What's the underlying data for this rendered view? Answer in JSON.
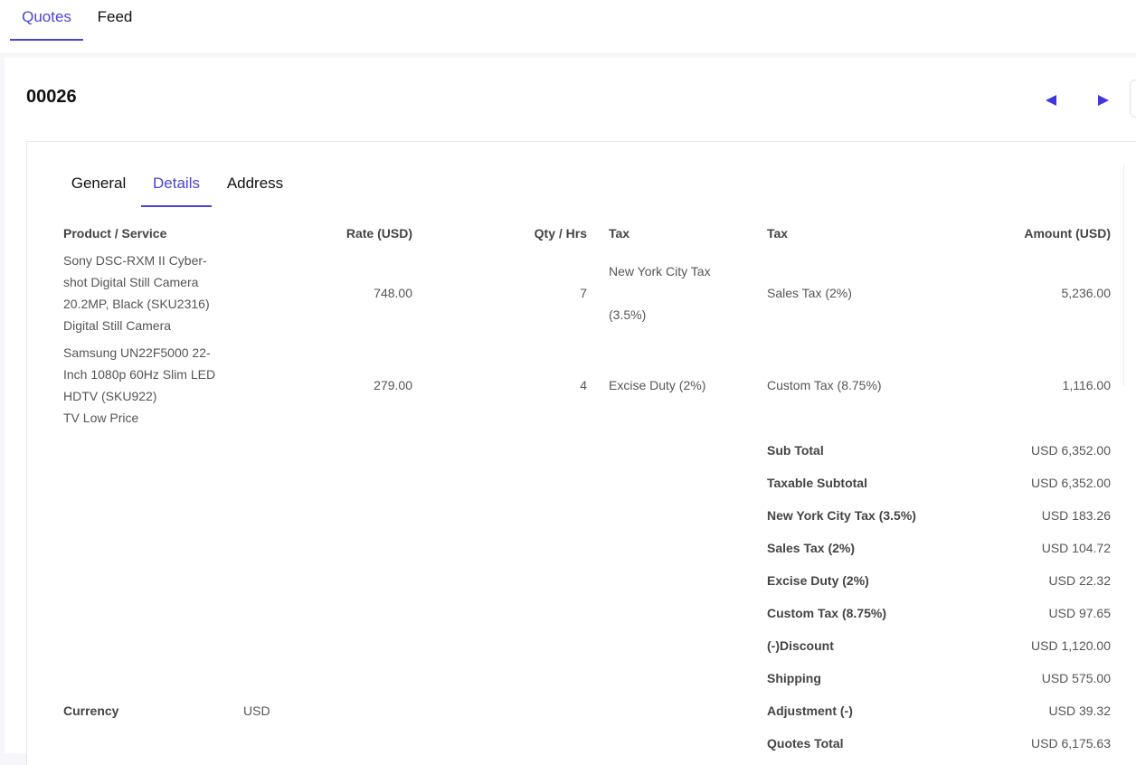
{
  "top_tabs": [
    {
      "label": "Quotes",
      "active": true
    },
    {
      "label": "Feed",
      "active": false
    }
  ],
  "record": {
    "id": "00026"
  },
  "sub_tabs": [
    {
      "label": "General",
      "active": false
    },
    {
      "label": "Details",
      "active": true
    },
    {
      "label": "Address",
      "active": false
    }
  ],
  "table": {
    "headers": [
      "Product / Service",
      "Rate (USD)",
      "Qty / Hrs",
      "Tax",
      "Tax",
      "Amount (USD)"
    ],
    "rows": [
      {
        "product_lines": [
          "Sony DSC-RXM II Cyber-",
          "shot Digital Still Camera",
          "20.2MP, Black (SKU2316)",
          "Digital Still Camera"
        ],
        "rate": "748.00",
        "qty": "7",
        "tax1_lines": [
          "New York City Tax",
          "(3.5%)"
        ],
        "tax2": "Sales Tax (2%)",
        "amount": "5,236.00"
      },
      {
        "product_lines": [
          "Samsung UN22F5000 22-",
          "Inch 1080p 60Hz Slim LED",
          "HDTV (SKU922)",
          "TV Low Price"
        ],
        "rate": "279.00",
        "qty": "4",
        "tax1_lines": [
          "Excise Duty (2%)"
        ],
        "tax2": "Custom Tax (8.75%)",
        "amount": "1,116.00"
      }
    ]
  },
  "summary": [
    {
      "label": "Sub Total",
      "value": "USD 6,352.00"
    },
    {
      "label": "Taxable Subtotal",
      "value": "USD 6,352.00"
    },
    {
      "label": "New York City Tax (3.5%)",
      "value": "USD 183.26"
    },
    {
      "label": "Sales Tax (2%)",
      "value": "USD 104.72"
    },
    {
      "label": "Excise Duty (2%)",
      "value": "USD 22.32"
    },
    {
      "label": "Custom Tax (8.75%)",
      "value": "USD 97.65"
    },
    {
      "label": "(-)Discount",
      "value": "USD 1,120.00"
    },
    {
      "label": "Shipping",
      "value": "USD 575.00"
    },
    {
      "label": "Adjustment (-)",
      "value": "USD 39.32"
    },
    {
      "label": "Quotes Total",
      "value": "USD 6,175.63"
    }
  ],
  "currency": {
    "label": "Currency",
    "value": "USD"
  },
  "colors": {
    "accent": "#4b43d6",
    "nav_arrow": "#3f37e0"
  },
  "icons": {
    "prev": "triangle-left-icon",
    "next": "triangle-right-icon"
  }
}
